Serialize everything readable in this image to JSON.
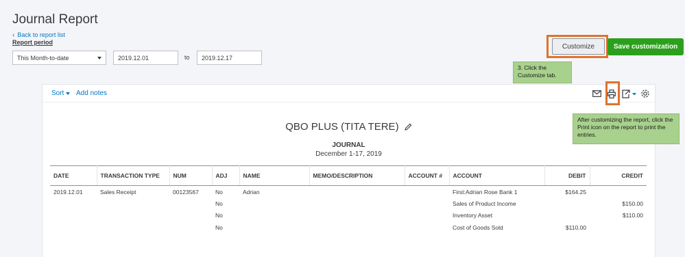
{
  "page": {
    "title": "Journal Report",
    "back_link": "Back to report list",
    "period_label": "Report period"
  },
  "filters": {
    "period_value": "This Month-to-date",
    "start_date": "2019.12.01",
    "to_label": "to",
    "end_date": "2019.12.17"
  },
  "actions": {
    "customize_label": "Customize",
    "save_label": "Save customization"
  },
  "callouts": {
    "step3": "3. Click the Customize tab.",
    "print_note": "After customizing the report, click the Print icon on the report to print the entries."
  },
  "toolbar": {
    "sort_label": "Sort",
    "add_notes_label": "Add notes",
    "icons": [
      "mail-icon",
      "print-icon",
      "export-icon",
      "gear-icon"
    ]
  },
  "report": {
    "company": "QBO PLUS (TITA TERE)",
    "title": "JOURNAL",
    "range": "December 1-17, 2019",
    "columns": [
      "DATE",
      "TRANSACTION TYPE",
      "NUM",
      "ADJ",
      "NAME",
      "MEMO/DESCRIPTION",
      "ACCOUNT #",
      "ACCOUNT",
      "DEBIT",
      "CREDIT"
    ],
    "rows": [
      [
        "2019.12.01",
        "Sales Receipt",
        "00123567",
        "No",
        "Adrian",
        "",
        "",
        "First:Adrian Rose Bank 1",
        "$164.25",
        ""
      ],
      [
        "",
        "",
        "",
        "No",
        "",
        "",
        "",
        "Sales of Product Income",
        "",
        "$150.00"
      ],
      [
        "",
        "",
        "",
        "No",
        "",
        "",
        "",
        "Inventory Asset",
        "",
        "$110.00"
      ],
      [
        "",
        "",
        "",
        "No",
        "",
        "",
        "",
        "Cost of Goods Sold",
        "$110.00",
        ""
      ]
    ]
  },
  "colors": {
    "accent_blue": "#0077c5",
    "save_green": "#2ca01c",
    "highlight_orange": "#e0722c",
    "callout_green": "#a9d18e"
  }
}
